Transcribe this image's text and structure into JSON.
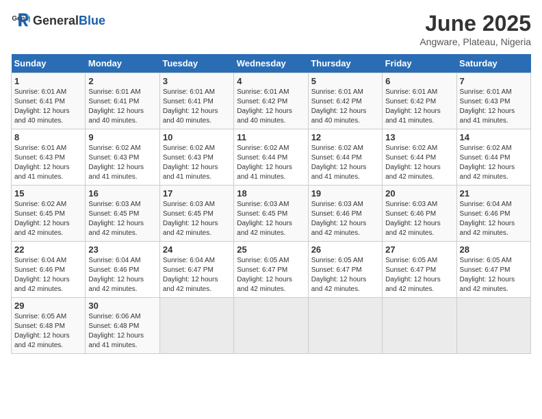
{
  "logo": {
    "general": "General",
    "blue": "Blue"
  },
  "title": "June 2025",
  "subtitle": "Angware, Plateau, Nigeria",
  "headers": [
    "Sunday",
    "Monday",
    "Tuesday",
    "Wednesday",
    "Thursday",
    "Friday",
    "Saturday"
  ],
  "weeks": [
    [
      {
        "day": "1",
        "sunrise": "6:01 AM",
        "sunset": "6:41 PM",
        "daylight": "12 hours and 40 minutes."
      },
      {
        "day": "2",
        "sunrise": "6:01 AM",
        "sunset": "6:41 PM",
        "daylight": "12 hours and 40 minutes."
      },
      {
        "day": "3",
        "sunrise": "6:01 AM",
        "sunset": "6:41 PM",
        "daylight": "12 hours and 40 minutes."
      },
      {
        "day": "4",
        "sunrise": "6:01 AM",
        "sunset": "6:42 PM",
        "daylight": "12 hours and 40 minutes."
      },
      {
        "day": "5",
        "sunrise": "6:01 AM",
        "sunset": "6:42 PM",
        "daylight": "12 hours and 40 minutes."
      },
      {
        "day": "6",
        "sunrise": "6:01 AM",
        "sunset": "6:42 PM",
        "daylight": "12 hours and 41 minutes."
      },
      {
        "day": "7",
        "sunrise": "6:01 AM",
        "sunset": "6:43 PM",
        "daylight": "12 hours and 41 minutes."
      }
    ],
    [
      {
        "day": "8",
        "sunrise": "6:01 AM",
        "sunset": "6:43 PM",
        "daylight": "12 hours and 41 minutes."
      },
      {
        "day": "9",
        "sunrise": "6:02 AM",
        "sunset": "6:43 PM",
        "daylight": "12 hours and 41 minutes."
      },
      {
        "day": "10",
        "sunrise": "6:02 AM",
        "sunset": "6:43 PM",
        "daylight": "12 hours and 41 minutes."
      },
      {
        "day": "11",
        "sunrise": "6:02 AM",
        "sunset": "6:44 PM",
        "daylight": "12 hours and 41 minutes."
      },
      {
        "day": "12",
        "sunrise": "6:02 AM",
        "sunset": "6:44 PM",
        "daylight": "12 hours and 41 minutes."
      },
      {
        "day": "13",
        "sunrise": "6:02 AM",
        "sunset": "6:44 PM",
        "daylight": "12 hours and 42 minutes."
      },
      {
        "day": "14",
        "sunrise": "6:02 AM",
        "sunset": "6:44 PM",
        "daylight": "12 hours and 42 minutes."
      }
    ],
    [
      {
        "day": "15",
        "sunrise": "6:02 AM",
        "sunset": "6:45 PM",
        "daylight": "12 hours and 42 minutes."
      },
      {
        "day": "16",
        "sunrise": "6:03 AM",
        "sunset": "6:45 PM",
        "daylight": "12 hours and 42 minutes."
      },
      {
        "day": "17",
        "sunrise": "6:03 AM",
        "sunset": "6:45 PM",
        "daylight": "12 hours and 42 minutes."
      },
      {
        "day": "18",
        "sunrise": "6:03 AM",
        "sunset": "6:45 PM",
        "daylight": "12 hours and 42 minutes."
      },
      {
        "day": "19",
        "sunrise": "6:03 AM",
        "sunset": "6:46 PM",
        "daylight": "12 hours and 42 minutes."
      },
      {
        "day": "20",
        "sunrise": "6:03 AM",
        "sunset": "6:46 PM",
        "daylight": "12 hours and 42 minutes."
      },
      {
        "day": "21",
        "sunrise": "6:04 AM",
        "sunset": "6:46 PM",
        "daylight": "12 hours and 42 minutes."
      }
    ],
    [
      {
        "day": "22",
        "sunrise": "6:04 AM",
        "sunset": "6:46 PM",
        "daylight": "12 hours and 42 minutes."
      },
      {
        "day": "23",
        "sunrise": "6:04 AM",
        "sunset": "6:46 PM",
        "daylight": "12 hours and 42 minutes."
      },
      {
        "day": "24",
        "sunrise": "6:04 AM",
        "sunset": "6:47 PM",
        "daylight": "12 hours and 42 minutes."
      },
      {
        "day": "25",
        "sunrise": "6:05 AM",
        "sunset": "6:47 PM",
        "daylight": "12 hours and 42 minutes."
      },
      {
        "day": "26",
        "sunrise": "6:05 AM",
        "sunset": "6:47 PM",
        "daylight": "12 hours and 42 minutes."
      },
      {
        "day": "27",
        "sunrise": "6:05 AM",
        "sunset": "6:47 PM",
        "daylight": "12 hours and 42 minutes."
      },
      {
        "day": "28",
        "sunrise": "6:05 AM",
        "sunset": "6:47 PM",
        "daylight": "12 hours and 42 minutes."
      }
    ],
    [
      {
        "day": "29",
        "sunrise": "6:05 AM",
        "sunset": "6:48 PM",
        "daylight": "12 hours and 42 minutes."
      },
      {
        "day": "30",
        "sunrise": "6:06 AM",
        "sunset": "6:48 PM",
        "daylight": "12 hours and 41 minutes."
      },
      null,
      null,
      null,
      null,
      null
    ]
  ],
  "labels": {
    "sunrise": "Sunrise: ",
    "sunset": "Sunset: ",
    "daylight": "Daylight: "
  }
}
